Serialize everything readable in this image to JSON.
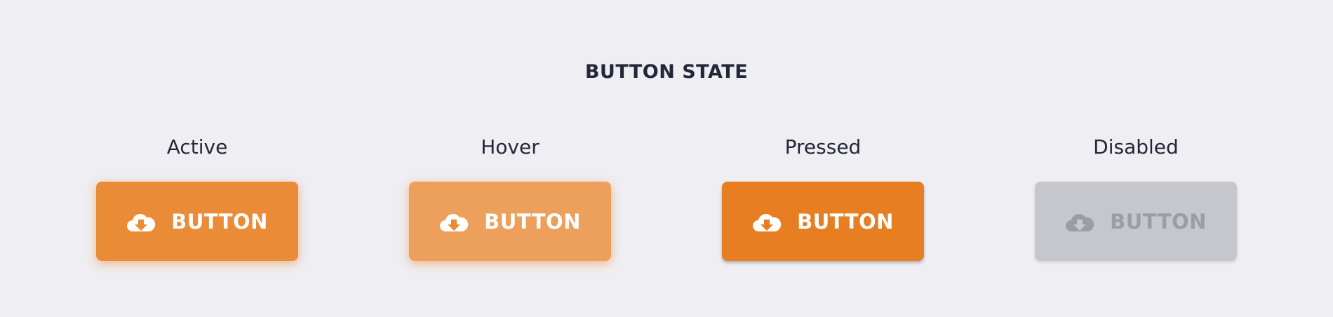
{
  "title": "BUTTON STATE",
  "states": [
    {
      "label": "Active",
      "button_label": "BUTTON",
      "bg": "#ea8b37",
      "fg": "#ffffff",
      "icon": "cloud-download-icon"
    },
    {
      "label": "Hover",
      "button_label": "BUTTON",
      "bg": "#eda05c",
      "fg": "#ffffff",
      "icon": "cloud-download-icon"
    },
    {
      "label": "Pressed",
      "button_label": "BUTTON",
      "bg": "#e77e22",
      "fg": "#ffffff",
      "icon": "cloud-download-icon"
    },
    {
      "label": "Disabled",
      "button_label": "BUTTON",
      "bg": "#c6c7cd",
      "fg": "#9b9ca6",
      "icon": "cloud-download-icon"
    }
  ],
  "colors": {
    "background": "#efeef3",
    "text": "#232838",
    "accent": "#ea8b37"
  }
}
